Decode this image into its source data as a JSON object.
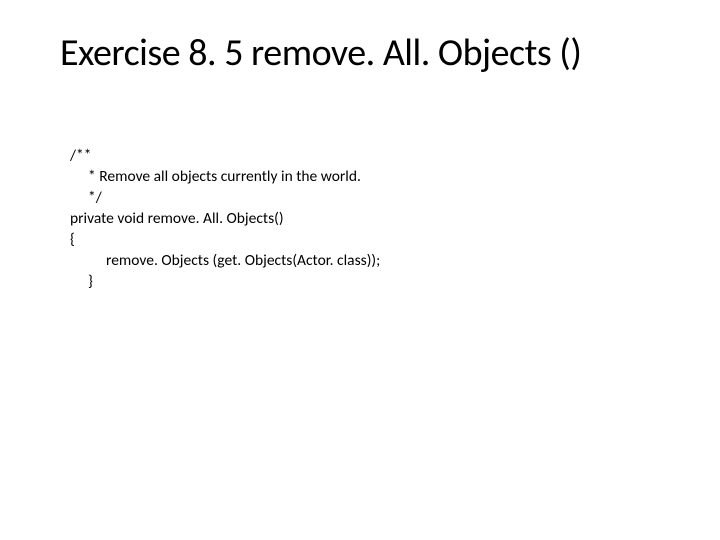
{
  "title": "Exercise 8. 5 remove. All. Objects ()",
  "code": {
    "line1": "/**",
    "line2": "* Remove all objects currently in the world.",
    "line3": "*/",
    "line4": "private void remove. All. Objects()",
    "line5": "{",
    "line6": "remove. Objects (get. Objects(Actor. class));",
    "line7": "}"
  }
}
